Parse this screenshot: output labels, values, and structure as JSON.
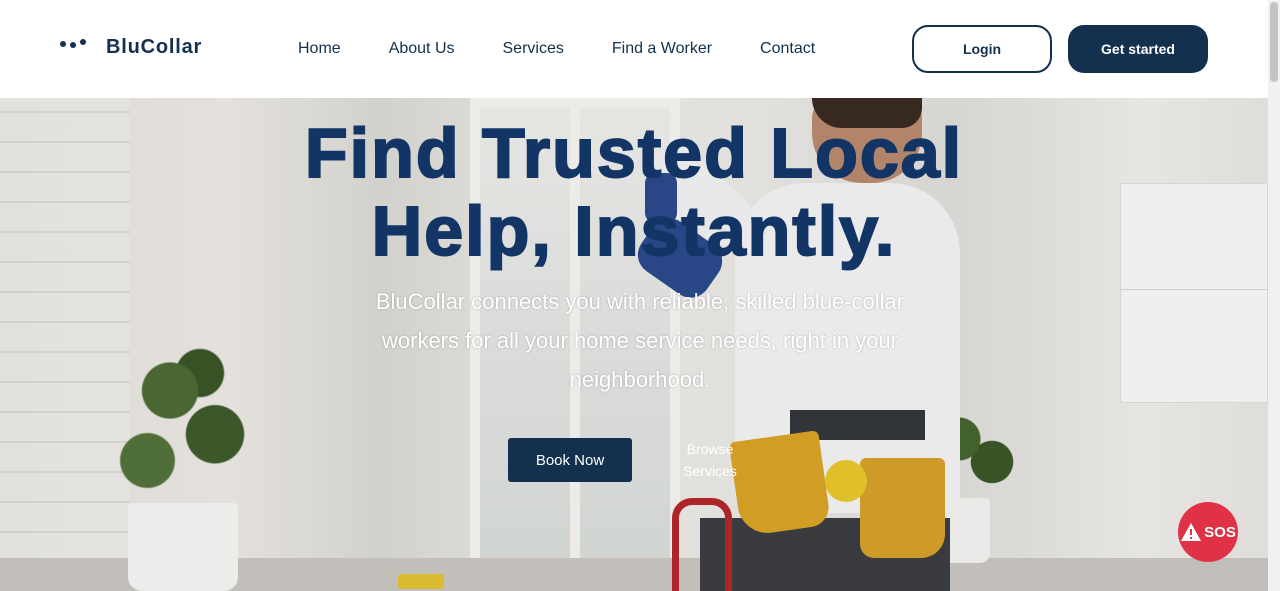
{
  "header": {
    "brand": "BluCollar",
    "nav": [
      "Home",
      "About Us",
      "Services",
      "Find a Worker",
      "Contact"
    ],
    "login_label": "Login",
    "get_started_label": "Get started"
  },
  "hero": {
    "title_line1": "Find Trusted Local",
    "title_line2": "Help, Instantly.",
    "subtitle": "BluCollar connects you with reliable, skilled blue-collar workers for all your home service needs, right in your neighborhood.",
    "book_label": "Book Now",
    "browse_label": "Browse Services"
  },
  "sos": {
    "label": "SOS",
    "icon": "warning-icon"
  },
  "colors": {
    "brand_navy": "#13304f",
    "title_blue": "#133566",
    "sos_red": "#e03246"
  }
}
